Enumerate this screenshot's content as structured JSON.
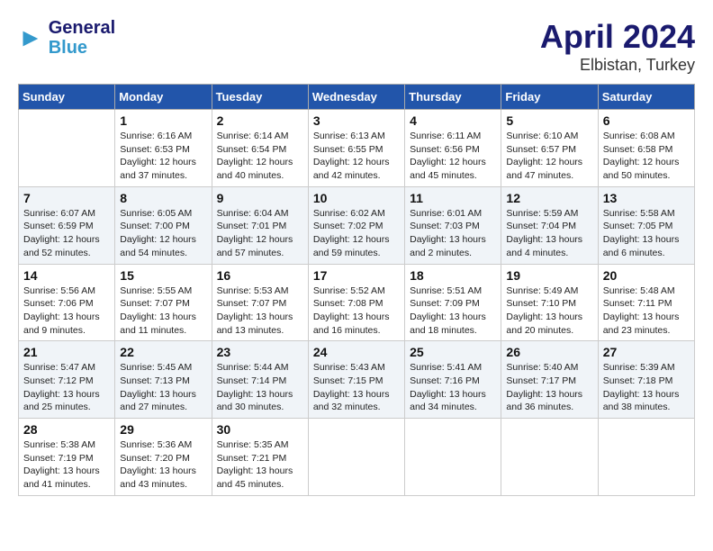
{
  "header": {
    "logo_line1": "General",
    "logo_line2": "Blue",
    "title": "April 2024",
    "subtitle": "Elbistan, Turkey"
  },
  "days_of_week": [
    "Sunday",
    "Monday",
    "Tuesday",
    "Wednesday",
    "Thursday",
    "Friday",
    "Saturday"
  ],
  "weeks": [
    [
      {
        "num": "",
        "info": ""
      },
      {
        "num": "1",
        "info": "Sunrise: 6:16 AM\nSunset: 6:53 PM\nDaylight: 12 hours\nand 37 minutes."
      },
      {
        "num": "2",
        "info": "Sunrise: 6:14 AM\nSunset: 6:54 PM\nDaylight: 12 hours\nand 40 minutes."
      },
      {
        "num": "3",
        "info": "Sunrise: 6:13 AM\nSunset: 6:55 PM\nDaylight: 12 hours\nand 42 minutes."
      },
      {
        "num": "4",
        "info": "Sunrise: 6:11 AM\nSunset: 6:56 PM\nDaylight: 12 hours\nand 45 minutes."
      },
      {
        "num": "5",
        "info": "Sunrise: 6:10 AM\nSunset: 6:57 PM\nDaylight: 12 hours\nand 47 minutes."
      },
      {
        "num": "6",
        "info": "Sunrise: 6:08 AM\nSunset: 6:58 PM\nDaylight: 12 hours\nand 50 minutes."
      }
    ],
    [
      {
        "num": "7",
        "info": "Sunrise: 6:07 AM\nSunset: 6:59 PM\nDaylight: 12 hours\nand 52 minutes."
      },
      {
        "num": "8",
        "info": "Sunrise: 6:05 AM\nSunset: 7:00 PM\nDaylight: 12 hours\nand 54 minutes."
      },
      {
        "num": "9",
        "info": "Sunrise: 6:04 AM\nSunset: 7:01 PM\nDaylight: 12 hours\nand 57 minutes."
      },
      {
        "num": "10",
        "info": "Sunrise: 6:02 AM\nSunset: 7:02 PM\nDaylight: 12 hours\nand 59 minutes."
      },
      {
        "num": "11",
        "info": "Sunrise: 6:01 AM\nSunset: 7:03 PM\nDaylight: 13 hours\nand 2 minutes."
      },
      {
        "num": "12",
        "info": "Sunrise: 5:59 AM\nSunset: 7:04 PM\nDaylight: 13 hours\nand 4 minutes."
      },
      {
        "num": "13",
        "info": "Sunrise: 5:58 AM\nSunset: 7:05 PM\nDaylight: 13 hours\nand 6 minutes."
      }
    ],
    [
      {
        "num": "14",
        "info": "Sunrise: 5:56 AM\nSunset: 7:06 PM\nDaylight: 13 hours\nand 9 minutes."
      },
      {
        "num": "15",
        "info": "Sunrise: 5:55 AM\nSunset: 7:07 PM\nDaylight: 13 hours\nand 11 minutes."
      },
      {
        "num": "16",
        "info": "Sunrise: 5:53 AM\nSunset: 7:07 PM\nDaylight: 13 hours\nand 13 minutes."
      },
      {
        "num": "17",
        "info": "Sunrise: 5:52 AM\nSunset: 7:08 PM\nDaylight: 13 hours\nand 16 minutes."
      },
      {
        "num": "18",
        "info": "Sunrise: 5:51 AM\nSunset: 7:09 PM\nDaylight: 13 hours\nand 18 minutes."
      },
      {
        "num": "19",
        "info": "Sunrise: 5:49 AM\nSunset: 7:10 PM\nDaylight: 13 hours\nand 20 minutes."
      },
      {
        "num": "20",
        "info": "Sunrise: 5:48 AM\nSunset: 7:11 PM\nDaylight: 13 hours\nand 23 minutes."
      }
    ],
    [
      {
        "num": "21",
        "info": "Sunrise: 5:47 AM\nSunset: 7:12 PM\nDaylight: 13 hours\nand 25 minutes."
      },
      {
        "num": "22",
        "info": "Sunrise: 5:45 AM\nSunset: 7:13 PM\nDaylight: 13 hours\nand 27 minutes."
      },
      {
        "num": "23",
        "info": "Sunrise: 5:44 AM\nSunset: 7:14 PM\nDaylight: 13 hours\nand 30 minutes."
      },
      {
        "num": "24",
        "info": "Sunrise: 5:43 AM\nSunset: 7:15 PM\nDaylight: 13 hours\nand 32 minutes."
      },
      {
        "num": "25",
        "info": "Sunrise: 5:41 AM\nSunset: 7:16 PM\nDaylight: 13 hours\nand 34 minutes."
      },
      {
        "num": "26",
        "info": "Sunrise: 5:40 AM\nSunset: 7:17 PM\nDaylight: 13 hours\nand 36 minutes."
      },
      {
        "num": "27",
        "info": "Sunrise: 5:39 AM\nSunset: 7:18 PM\nDaylight: 13 hours\nand 38 minutes."
      }
    ],
    [
      {
        "num": "28",
        "info": "Sunrise: 5:38 AM\nSunset: 7:19 PM\nDaylight: 13 hours\nand 41 minutes."
      },
      {
        "num": "29",
        "info": "Sunrise: 5:36 AM\nSunset: 7:20 PM\nDaylight: 13 hours\nand 43 minutes."
      },
      {
        "num": "30",
        "info": "Sunrise: 5:35 AM\nSunset: 7:21 PM\nDaylight: 13 hours\nand 45 minutes."
      },
      {
        "num": "",
        "info": ""
      },
      {
        "num": "",
        "info": ""
      },
      {
        "num": "",
        "info": ""
      },
      {
        "num": "",
        "info": ""
      }
    ]
  ]
}
